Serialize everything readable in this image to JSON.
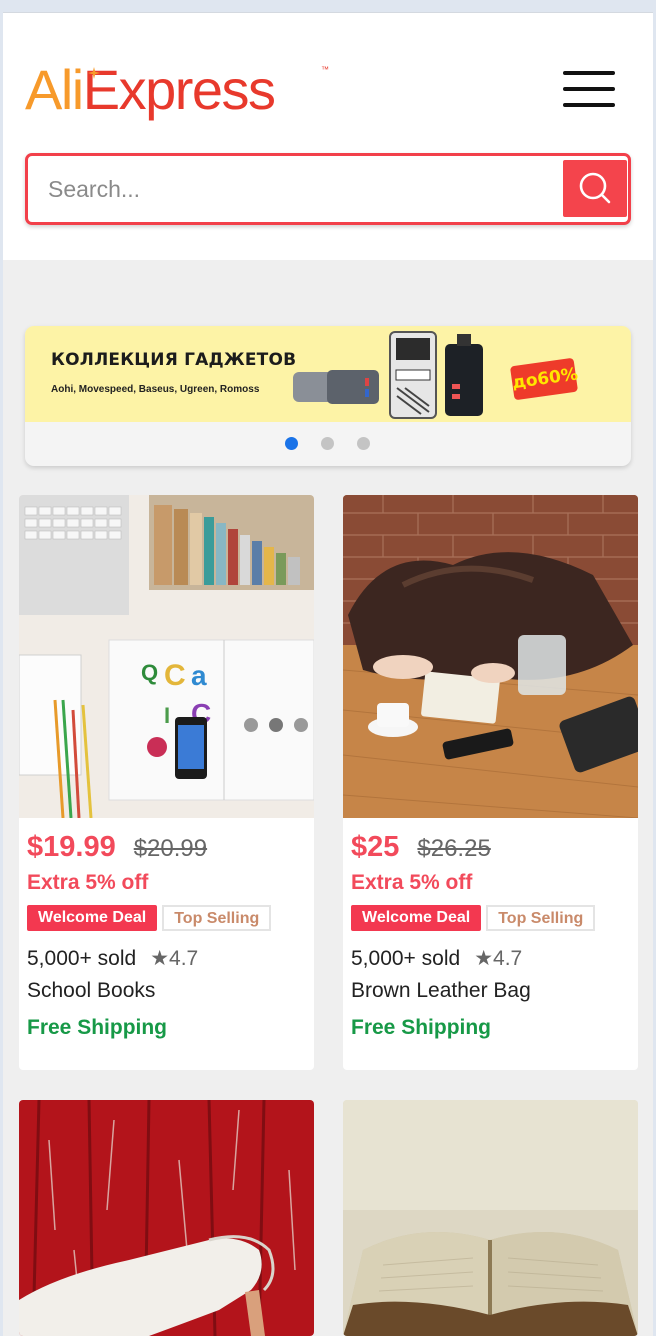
{
  "header": {
    "logo_part_ali": "Ali",
    "logo_part_express": "Express",
    "logo_tm": "™"
  },
  "search": {
    "placeholder": "Search...",
    "value": ""
  },
  "banner": {
    "title": "КОЛЛЕКЦИЯ ГАДЖЕТОВ",
    "subtitle": "Aohi, Movespeed, Baseus, Ugreen, Romoss",
    "badge": "до60%",
    "active_slide": 1,
    "slide_count": 3
  },
  "products": [
    {
      "price": "$19.99",
      "old_price": "$20.99",
      "extra": "Extra 5% off",
      "tag_deal": "Welcome Deal",
      "tag_top": "Top Selling",
      "sold": "5,000+ sold",
      "rating": "★4.7",
      "name": "School Books",
      "shipping": "Free Shipping",
      "image": "desk-with-books-laptop-photo"
    },
    {
      "price": "$25",
      "old_price": "$26.25",
      "extra": "Extra 5% off",
      "tag_deal": "Welcome Deal",
      "tag_top": "Top Selling",
      "sold": "5,000+ sold",
      "rating": "★4.7",
      "name": "Brown Leather Bag",
      "shipping": "Free Shipping",
      "image": "leather-bag-on-table-photo"
    },
    {
      "image": "white-heels-red-wall-photo"
    },
    {
      "image": "open-book-photo"
    }
  ],
  "colors": {
    "accent_red": "#f2404a",
    "price_red": "#f24a5b",
    "shipping_green": "#179947",
    "logo_orange": "#f79a2b",
    "active_dot": "#1a73e8"
  }
}
